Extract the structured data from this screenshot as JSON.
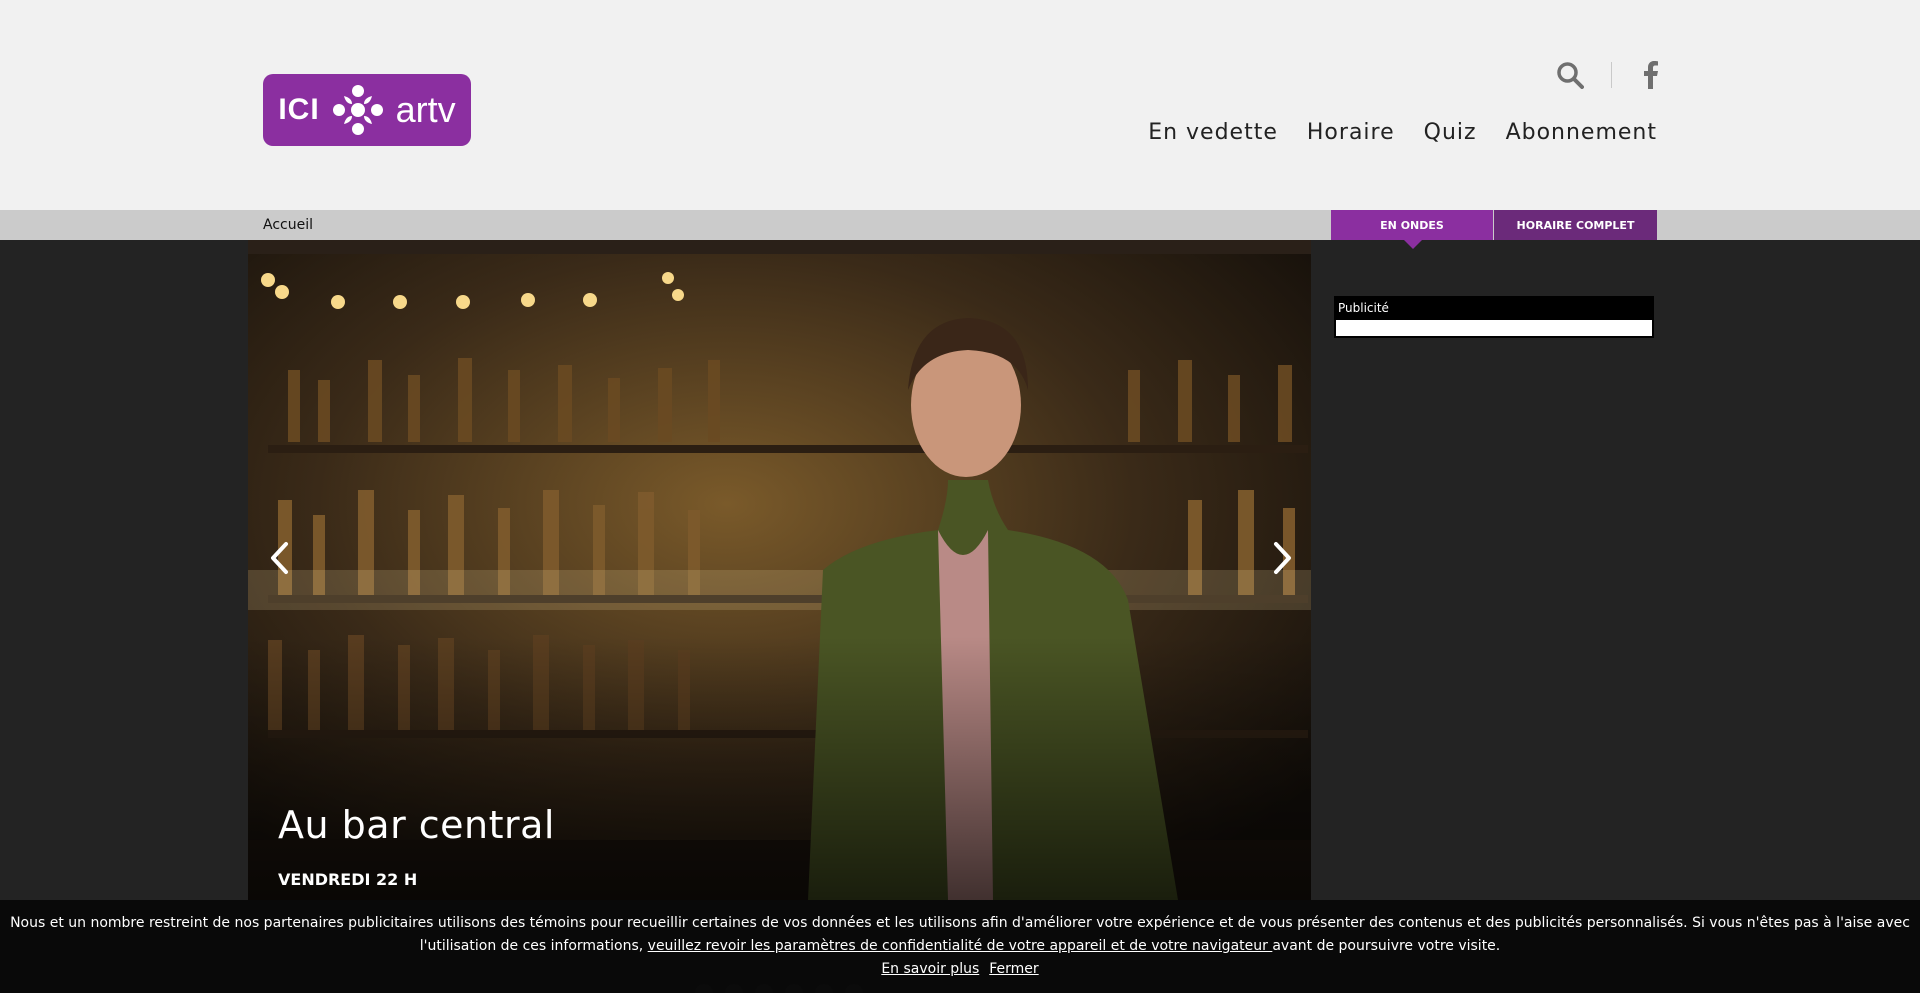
{
  "header": {
    "logo": {
      "ici": "ICI",
      "artv": "artv"
    },
    "nav": [
      "En vedette",
      "Horaire",
      "Quiz",
      "Abonnement"
    ],
    "icons": [
      "search-icon",
      "facebook-icon"
    ]
  },
  "breadcrumb": "Accueil",
  "tabs": {
    "on_air": "EN ONDES",
    "full_schedule": "HORAIRE COMPLET"
  },
  "hero": {
    "title": "Au bar central",
    "time": "VENDREDI 22 H"
  },
  "ad": {
    "label": "Publicité"
  },
  "cookie": {
    "text_before": "Nous et un nombre restreint de nos partenaires publicitaires utilisons des témoins pour recueillir certaines de vos données et les utilisons afin d'améliorer votre expérience et de vous présenter des contenus et des publicités personnalisés. Si vous n'êtes pas à l'aise avec l'utilisation de ces informations, ",
    "link": "veuillez revoir les paramètres de confidentialité de votre appareil et de votre navigateur ",
    "text_after": "avant de poursuivre votre visite.",
    "learn_more": "En savoir plus",
    "close": "Fermer"
  },
  "colors": {
    "brand": "#8b2fa0",
    "brand_dark": "#6b2a7a",
    "page_dark": "#232323",
    "header_bg": "#f1f1f1",
    "strip": "#cbcbcb"
  }
}
